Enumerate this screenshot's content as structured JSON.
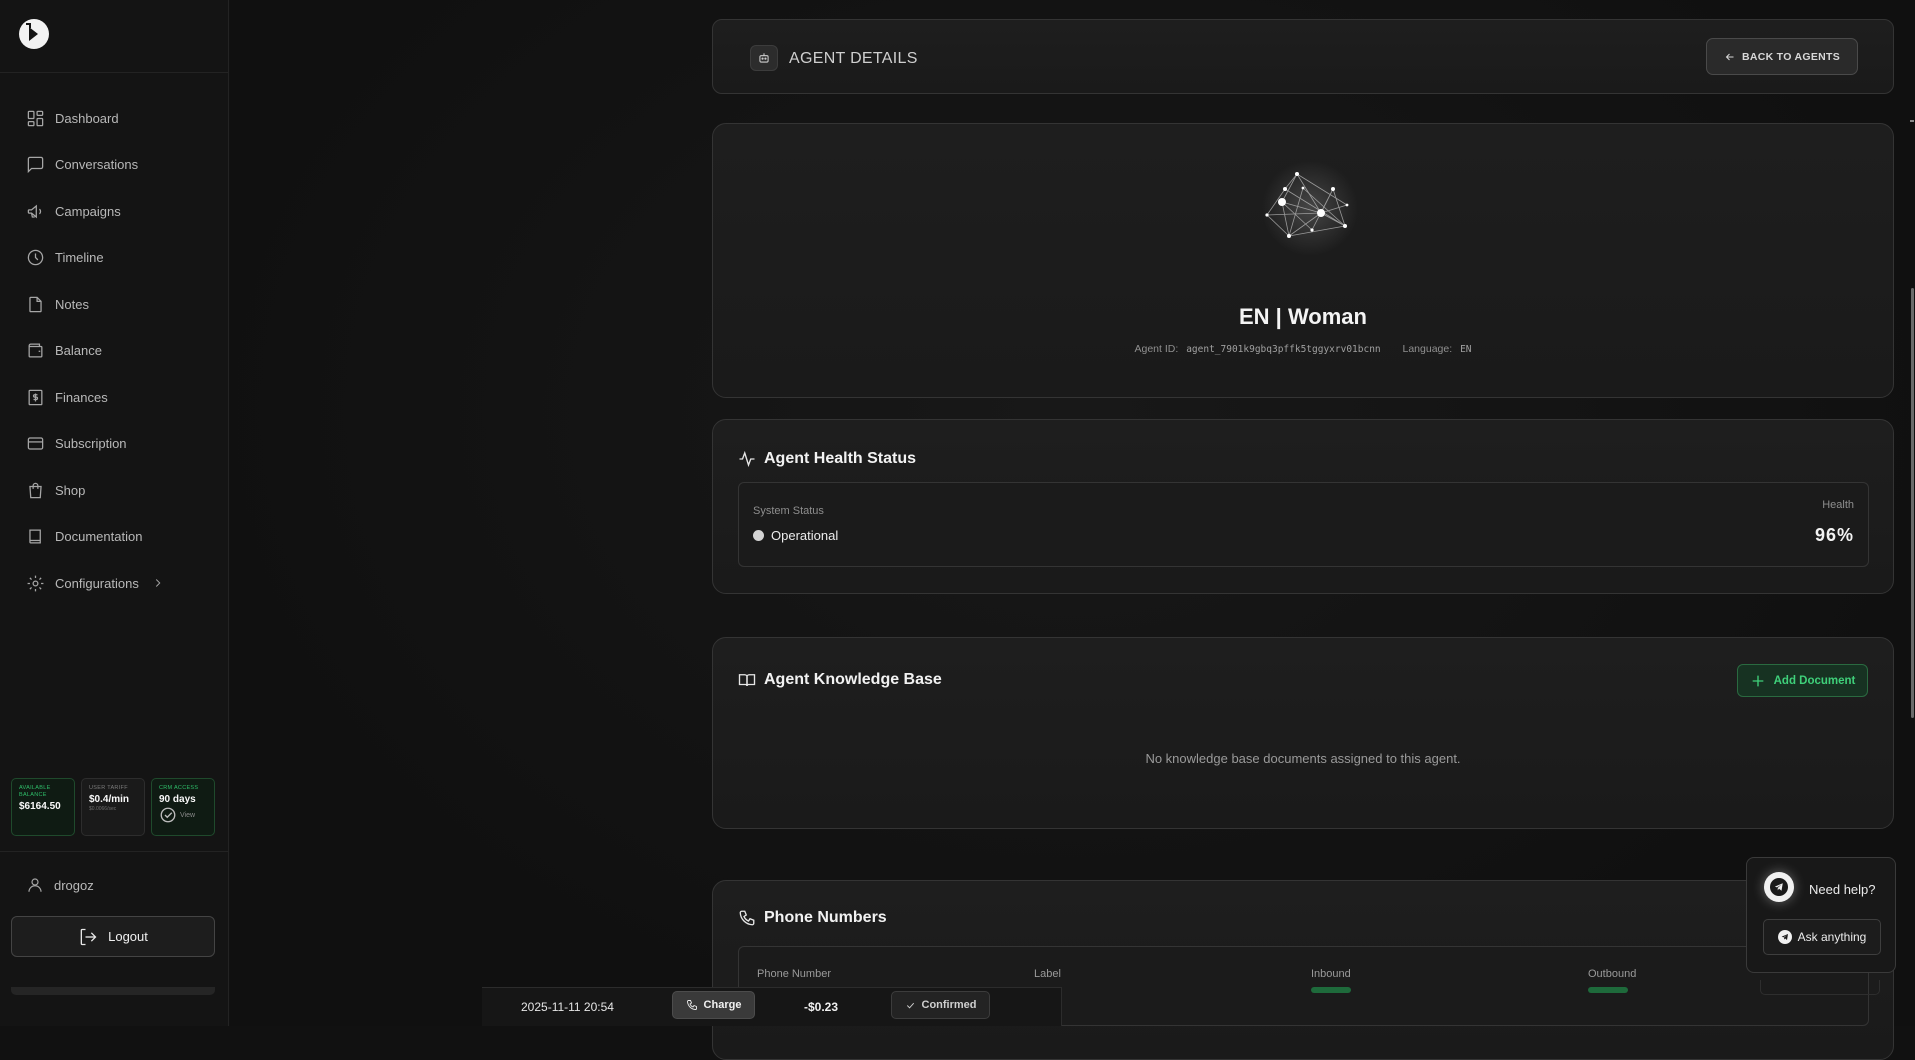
{
  "sidebar": {
    "items": [
      {
        "label": "Dashboard"
      },
      {
        "label": "Conversations"
      },
      {
        "label": "Campaigns"
      },
      {
        "label": "Timeline"
      },
      {
        "label": "Notes"
      },
      {
        "label": "Balance"
      },
      {
        "label": "Finances"
      },
      {
        "label": "Subscription"
      },
      {
        "label": "Shop"
      },
      {
        "label": "Documentation"
      },
      {
        "label": "Configurations"
      }
    ],
    "stats": {
      "balance_label": "Available Balance",
      "balance_value": "$6164.50",
      "tariff_label": "User Tariff",
      "tariff_value": "$0.4/min",
      "tariff_sub": "$0.0066/sec",
      "crm_label": "CRM Access",
      "crm_value": "90 days",
      "crm_view": "View"
    },
    "user": "drogoz",
    "logout": "Logout"
  },
  "header": {
    "title": "AGENT DETAILS",
    "back_label": "BACK TO AGENTS"
  },
  "agent": {
    "name": "EN | Woman",
    "id_label": "Agent ID:",
    "id_value": "agent_7901k9gbq3pffk5tggyxrv01bcnn",
    "language_label": "Language:",
    "language_value": "EN"
  },
  "health": {
    "title": "Agent Health Status",
    "system_status_label": "System Status",
    "system_status_value": "Operational",
    "health_label": "Health",
    "health_value": "96%"
  },
  "knowledge": {
    "title": "Agent Knowledge Base",
    "add_label": "Add Document",
    "empty_text": "No knowledge base documents assigned to this agent."
  },
  "phones": {
    "title": "Phone Numbers",
    "columns": [
      "Phone Number",
      "Label",
      "Inbound",
      "Outbound"
    ]
  },
  "transaction": {
    "date": "2025-11-11 20:54",
    "type": "Charge",
    "amount": "-$0.23",
    "status": "Confirmed"
  },
  "help": {
    "title": "Need help?",
    "ask_label": "Ask anything"
  },
  "colors": {
    "accent_green": "#3fd07a",
    "background": "#111111"
  }
}
